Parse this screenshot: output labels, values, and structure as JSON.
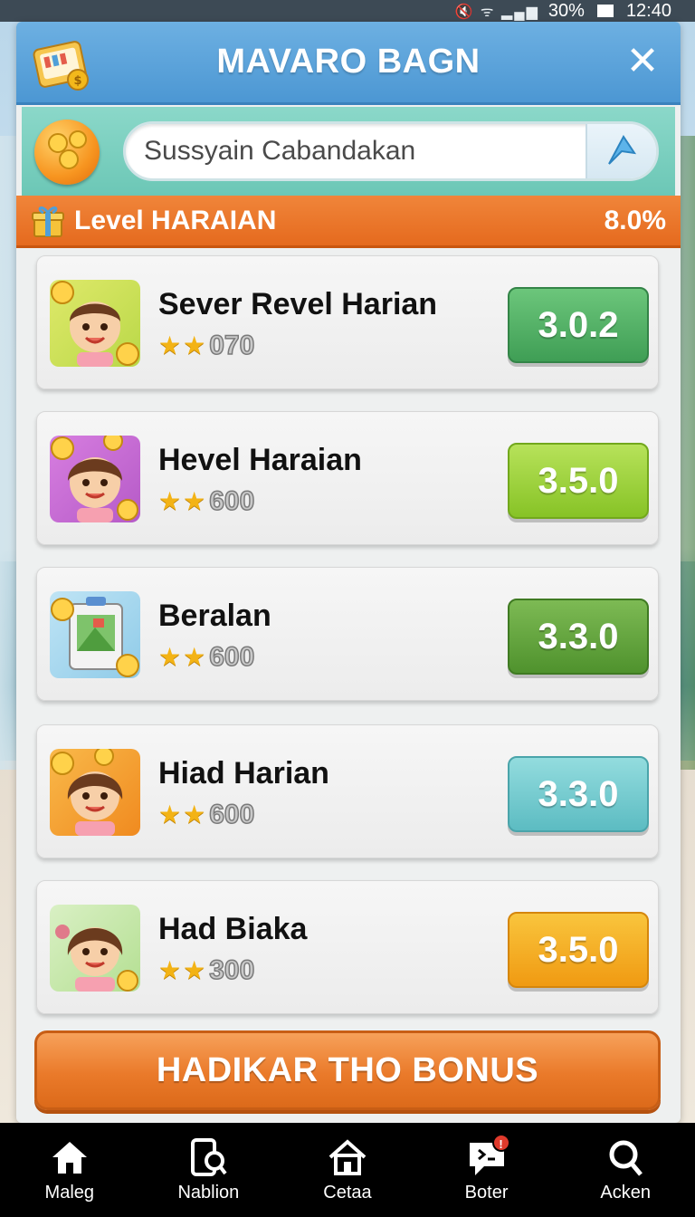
{
  "status_bar": {
    "battery": "30%",
    "time": "12:40"
  },
  "header": {
    "title": "MAVARO BAGN",
    "close_icon": "close-icon",
    "logo_icon": "ticket-coins-icon"
  },
  "search": {
    "placeholder": "Sussyain Cabandakan",
    "go_icon": "send-arrow-icon"
  },
  "level": {
    "label": "Level HARAIAN",
    "percent": "8.0%",
    "icon": "gift-icon"
  },
  "items": [
    {
      "title": "Sever Revel Harian",
      "rating": "070",
      "button": "3.0.2",
      "icon": "avatar-boy-icon",
      "color": "#3f9e55"
    },
    {
      "title": "Hevel Haraian",
      "rating": "600",
      "button": "3.5.0",
      "icon": "avatar-girl-icon",
      "color": "#87c326"
    },
    {
      "title": "Beralan",
      "rating": "600",
      "button": "3.3.0",
      "icon": "calendar-picture-icon",
      "color": "#4f922d"
    },
    {
      "title": "Hiad Harian",
      "rating": "600",
      "button": "3.3.0",
      "icon": "avatar-girl-icon",
      "color": "#5cbcc2"
    },
    {
      "title": "Had Biaka",
      "rating": "300",
      "button": "3.5.0",
      "icon": "avatar-girl-icon",
      "color": "#f09a12"
    }
  ],
  "bonus_button": "HADIKAR THO BONUS",
  "nav": [
    {
      "label": "Maleg",
      "icon": "home-icon"
    },
    {
      "label": "Nablion",
      "icon": "phone-search-icon"
    },
    {
      "label": "Cetaa",
      "icon": "house-icon"
    },
    {
      "label": "Boter",
      "icon": "message-icon",
      "badge": "!"
    },
    {
      "label": "Acken",
      "icon": "search-icon"
    }
  ]
}
